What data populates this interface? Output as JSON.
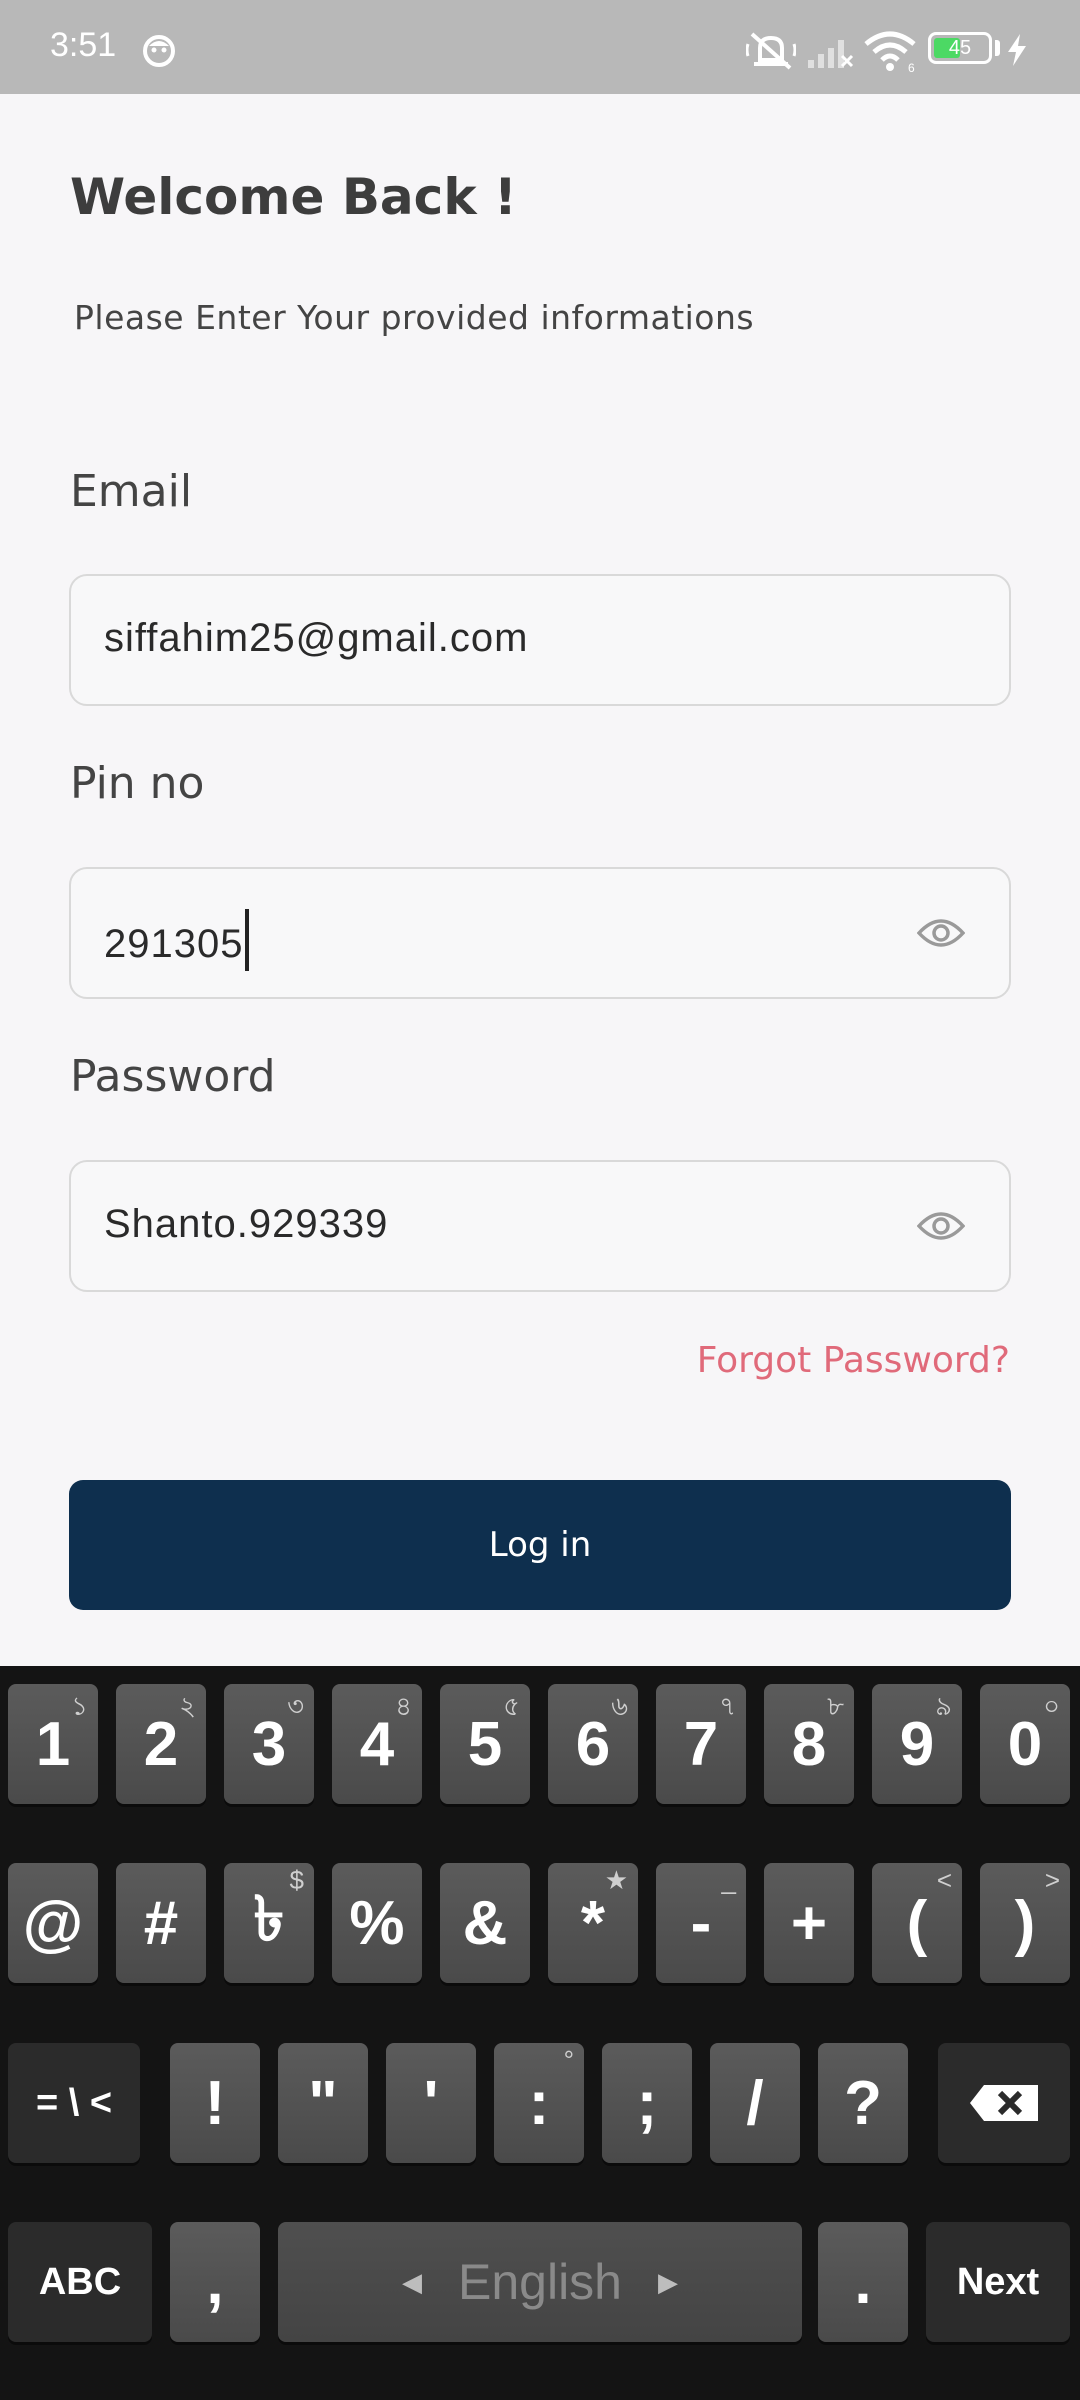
{
  "status_bar": {
    "time": "3:51",
    "battery_level": "45",
    "icons": [
      "face-icon",
      "mute-icon",
      "signal-icon",
      "wifi-icon",
      "battery-icon",
      "charging-icon"
    ]
  },
  "header": {
    "title": "Welcome Back !",
    "subtitle": "Please Enter Your provided informations"
  },
  "form": {
    "email_label": "Email",
    "email_value": "siffahim25@gmail.com",
    "pin_label": "Pin no",
    "pin_value": "291305",
    "password_label": "Password",
    "password_value": "Shanto.929339",
    "forgot_password": "Forgot Password?",
    "login_button": "Log in"
  },
  "colors": {
    "primary_button": "#0e2f4e",
    "forgot_link": "#e06a7a"
  },
  "keyboard": {
    "row1": [
      {
        "main": "1",
        "hint": "১"
      },
      {
        "main": "2",
        "hint": "২"
      },
      {
        "main": "3",
        "hint": "৩"
      },
      {
        "main": "4",
        "hint": "৪"
      },
      {
        "main": "5",
        "hint": "৫"
      },
      {
        "main": "6",
        "hint": "৬"
      },
      {
        "main": "7",
        "hint": "৭"
      },
      {
        "main": "8",
        "hint": "৮"
      },
      {
        "main": "9",
        "hint": "৯"
      },
      {
        "main": "0",
        "hint": "০"
      }
    ],
    "row2": [
      {
        "main": "@",
        "hint": ""
      },
      {
        "main": "#",
        "hint": ""
      },
      {
        "main": "৳",
        "hint": "$"
      },
      {
        "main": "%",
        "hint": ""
      },
      {
        "main": "&",
        "hint": ""
      },
      {
        "main": "*",
        "hint": "★"
      },
      {
        "main": "-",
        "hint": "_"
      },
      {
        "main": "+",
        "hint": ""
      },
      {
        "main": "(",
        "hint": "<"
      },
      {
        "main": ")",
        "hint": ">"
      }
    ],
    "row3_left": "= \\ <",
    "row3": [
      {
        "main": "!",
        "hint": ""
      },
      {
        "main": "\"",
        "hint": ""
      },
      {
        "main": "'",
        "hint": ""
      },
      {
        "main": ":",
        "hint": "°"
      },
      {
        "main": ";",
        "hint": ""
      },
      {
        "main": "/",
        "hint": ""
      },
      {
        "main": "?",
        "hint": ""
      }
    ],
    "abc": "ABC",
    "comma": ",",
    "space_label": "English",
    "period": ".",
    "next": "Next"
  }
}
